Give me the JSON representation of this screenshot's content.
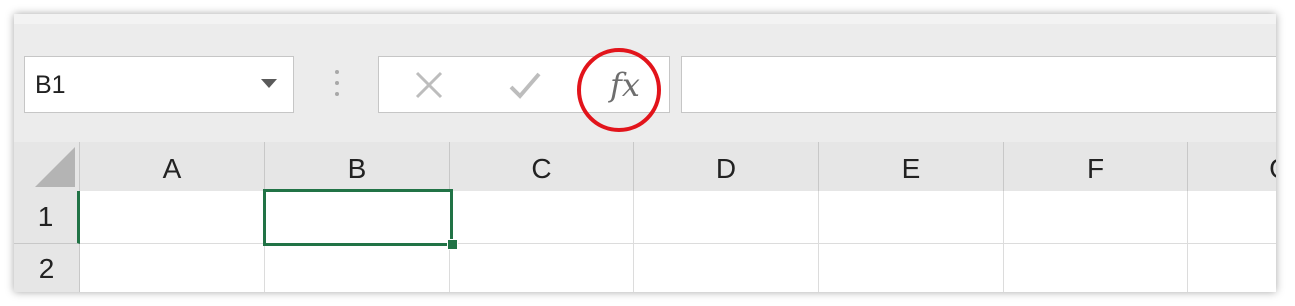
{
  "name_box": {
    "value": "B1"
  },
  "formula_bar": {
    "cancel_symbol": "✕",
    "enter_symbol": "✓",
    "insert_function_label": "fx",
    "formula_value": ""
  },
  "grid": {
    "columns": [
      "A",
      "B",
      "C",
      "D",
      "E",
      "F",
      "G"
    ],
    "rows": [
      "1",
      "2"
    ],
    "selected_cell": "B1"
  },
  "colors": {
    "selection": "#217346",
    "highlight": "#e2141b"
  }
}
